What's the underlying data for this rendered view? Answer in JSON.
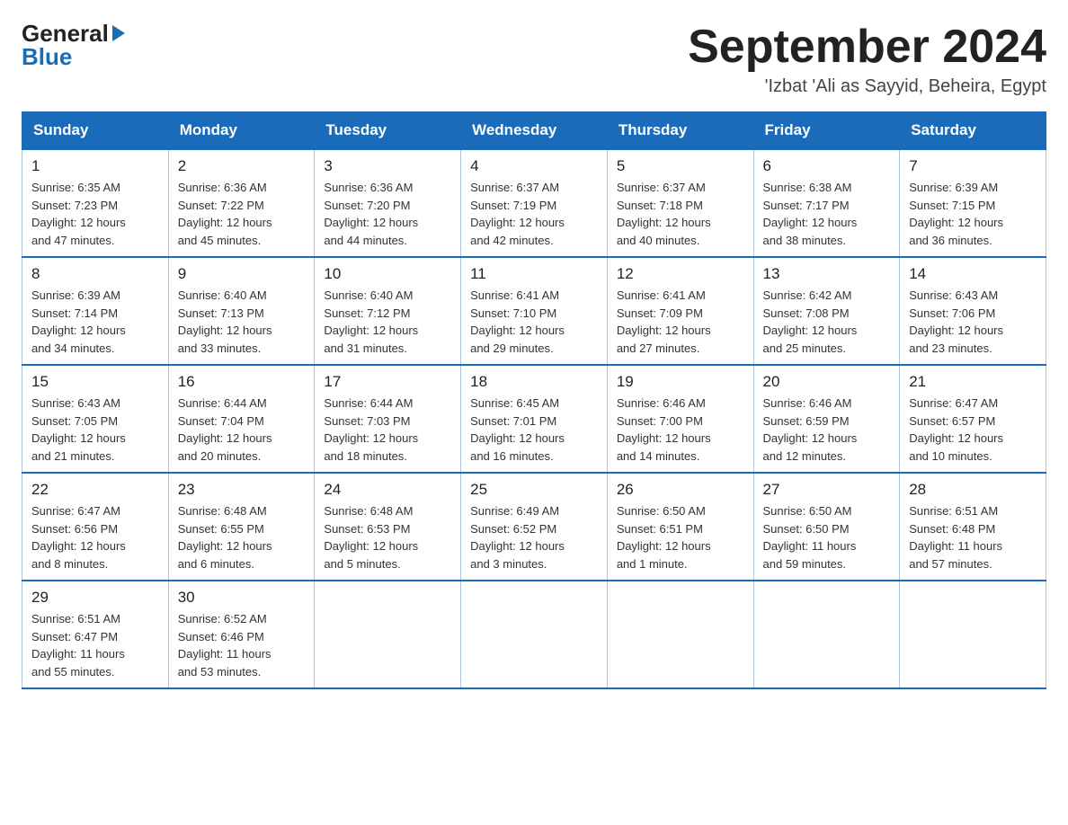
{
  "header": {
    "month_title": "September 2024",
    "location": "'Izbat 'Ali as Sayyid, Beheira, Egypt",
    "logo_general": "General",
    "logo_blue": "Blue"
  },
  "weekdays": [
    "Sunday",
    "Monday",
    "Tuesday",
    "Wednesday",
    "Thursday",
    "Friday",
    "Saturday"
  ],
  "weeks": [
    [
      {
        "day": "1",
        "sunrise": "6:35 AM",
        "sunset": "7:23 PM",
        "daylight": "12 hours and 47 minutes."
      },
      {
        "day": "2",
        "sunrise": "6:36 AM",
        "sunset": "7:22 PM",
        "daylight": "12 hours and 45 minutes."
      },
      {
        "day": "3",
        "sunrise": "6:36 AM",
        "sunset": "7:20 PM",
        "daylight": "12 hours and 44 minutes."
      },
      {
        "day": "4",
        "sunrise": "6:37 AM",
        "sunset": "7:19 PM",
        "daylight": "12 hours and 42 minutes."
      },
      {
        "day": "5",
        "sunrise": "6:37 AM",
        "sunset": "7:18 PM",
        "daylight": "12 hours and 40 minutes."
      },
      {
        "day": "6",
        "sunrise": "6:38 AM",
        "sunset": "7:17 PM",
        "daylight": "12 hours and 38 minutes."
      },
      {
        "day": "7",
        "sunrise": "6:39 AM",
        "sunset": "7:15 PM",
        "daylight": "12 hours and 36 minutes."
      }
    ],
    [
      {
        "day": "8",
        "sunrise": "6:39 AM",
        "sunset": "7:14 PM",
        "daylight": "12 hours and 34 minutes."
      },
      {
        "day": "9",
        "sunrise": "6:40 AM",
        "sunset": "7:13 PM",
        "daylight": "12 hours and 33 minutes."
      },
      {
        "day": "10",
        "sunrise": "6:40 AM",
        "sunset": "7:12 PM",
        "daylight": "12 hours and 31 minutes."
      },
      {
        "day": "11",
        "sunrise": "6:41 AM",
        "sunset": "7:10 PM",
        "daylight": "12 hours and 29 minutes."
      },
      {
        "day": "12",
        "sunrise": "6:41 AM",
        "sunset": "7:09 PM",
        "daylight": "12 hours and 27 minutes."
      },
      {
        "day": "13",
        "sunrise": "6:42 AM",
        "sunset": "7:08 PM",
        "daylight": "12 hours and 25 minutes."
      },
      {
        "day": "14",
        "sunrise": "6:43 AM",
        "sunset": "7:06 PM",
        "daylight": "12 hours and 23 minutes."
      }
    ],
    [
      {
        "day": "15",
        "sunrise": "6:43 AM",
        "sunset": "7:05 PM",
        "daylight": "12 hours and 21 minutes."
      },
      {
        "day": "16",
        "sunrise": "6:44 AM",
        "sunset": "7:04 PM",
        "daylight": "12 hours and 20 minutes."
      },
      {
        "day": "17",
        "sunrise": "6:44 AM",
        "sunset": "7:03 PM",
        "daylight": "12 hours and 18 minutes."
      },
      {
        "day": "18",
        "sunrise": "6:45 AM",
        "sunset": "7:01 PM",
        "daylight": "12 hours and 16 minutes."
      },
      {
        "day": "19",
        "sunrise": "6:46 AM",
        "sunset": "7:00 PM",
        "daylight": "12 hours and 14 minutes."
      },
      {
        "day": "20",
        "sunrise": "6:46 AM",
        "sunset": "6:59 PM",
        "daylight": "12 hours and 12 minutes."
      },
      {
        "day": "21",
        "sunrise": "6:47 AM",
        "sunset": "6:57 PM",
        "daylight": "12 hours and 10 minutes."
      }
    ],
    [
      {
        "day": "22",
        "sunrise": "6:47 AM",
        "sunset": "6:56 PM",
        "daylight": "12 hours and 8 minutes."
      },
      {
        "day": "23",
        "sunrise": "6:48 AM",
        "sunset": "6:55 PM",
        "daylight": "12 hours and 6 minutes."
      },
      {
        "day": "24",
        "sunrise": "6:48 AM",
        "sunset": "6:53 PM",
        "daylight": "12 hours and 5 minutes."
      },
      {
        "day": "25",
        "sunrise": "6:49 AM",
        "sunset": "6:52 PM",
        "daylight": "12 hours and 3 minutes."
      },
      {
        "day": "26",
        "sunrise": "6:50 AM",
        "sunset": "6:51 PM",
        "daylight": "12 hours and 1 minute."
      },
      {
        "day": "27",
        "sunrise": "6:50 AM",
        "sunset": "6:50 PM",
        "daylight": "11 hours and 59 minutes."
      },
      {
        "day": "28",
        "sunrise": "6:51 AM",
        "sunset": "6:48 PM",
        "daylight": "11 hours and 57 minutes."
      }
    ],
    [
      {
        "day": "29",
        "sunrise": "6:51 AM",
        "sunset": "6:47 PM",
        "daylight": "11 hours and 55 minutes."
      },
      {
        "day": "30",
        "sunrise": "6:52 AM",
        "sunset": "6:46 PM",
        "daylight": "11 hours and 53 minutes."
      },
      null,
      null,
      null,
      null,
      null
    ]
  ],
  "labels": {
    "sunrise": "Sunrise:",
    "sunset": "Sunset:",
    "daylight": "Daylight:"
  }
}
